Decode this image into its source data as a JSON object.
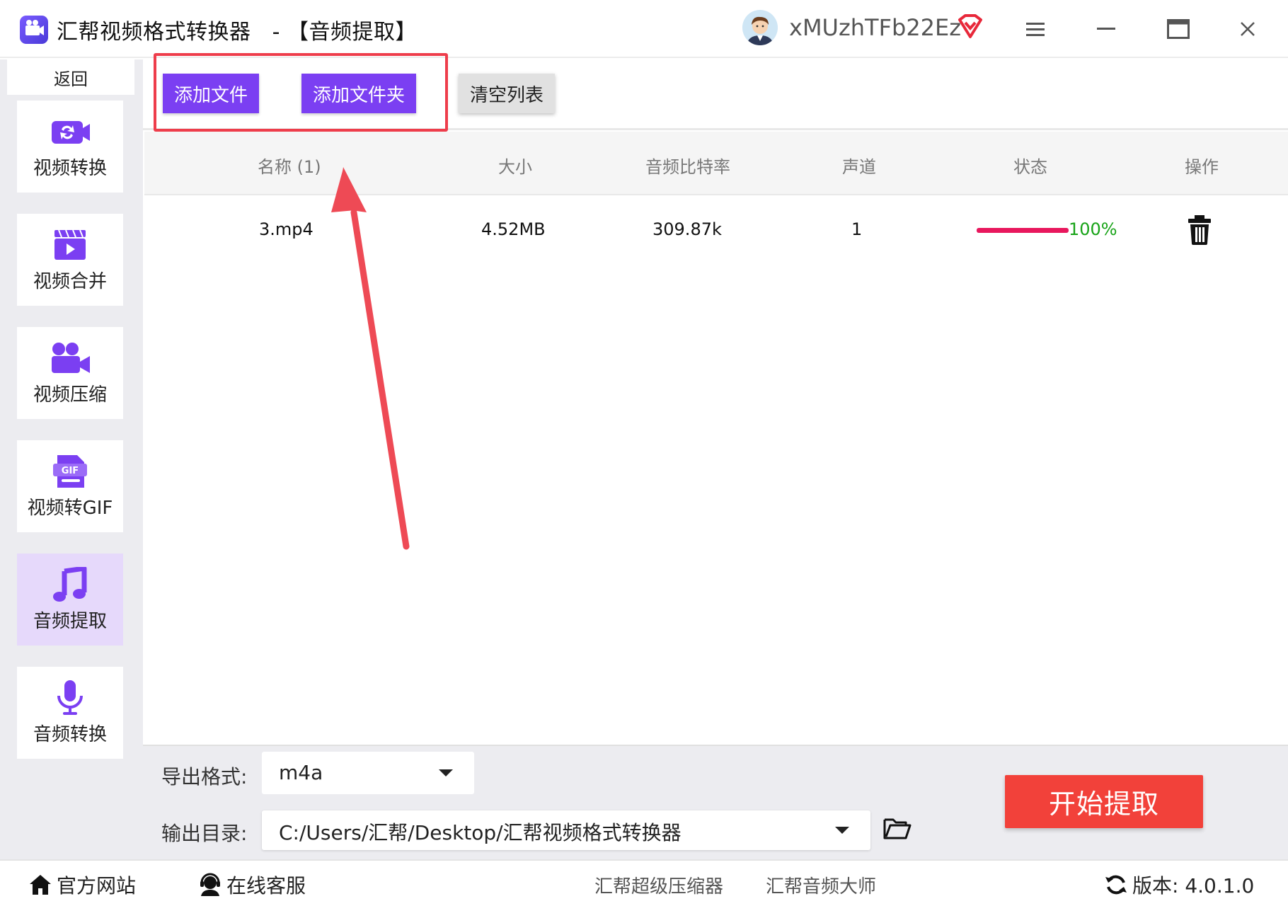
{
  "window": {
    "title": "汇帮视频格式转换器",
    "subtitle": "- 【音频提取】",
    "username": "xMUzhTFb22Ez",
    "icons": [
      "app-logo-icon",
      "avatar",
      "vip-icon",
      "menu-icon",
      "minimize-icon",
      "maximize-icon",
      "close-icon"
    ]
  },
  "sidebar": {
    "back_label": "返回",
    "items": [
      {
        "label": "视频转换",
        "icon": "video-convert-icon"
      },
      {
        "label": "视频合并",
        "icon": "video-merge-icon"
      },
      {
        "label": "视频压缩",
        "icon": "video-compress-icon"
      },
      {
        "label": "视频转GIF",
        "icon": "gif-icon"
      },
      {
        "label": "音频提取",
        "icon": "music-note-icon",
        "active": true
      },
      {
        "label": "音频转换",
        "icon": "microphone-icon"
      }
    ]
  },
  "toolbar": {
    "add_file": "添加文件",
    "add_folder": "添加文件夹",
    "clear_list": "清空列表"
  },
  "table": {
    "columns": [
      "名称 (1)",
      "大小",
      "音频比特率",
      "声道",
      "状态",
      "操作"
    ],
    "rows": [
      {
        "name": "3.mp4",
        "size": "4.52MB",
        "bitrate": "309.87k",
        "channels": "1",
        "progress": 1.0,
        "status_text": "100%"
      }
    ]
  },
  "settings": {
    "format_label": "导出格式:",
    "format_value": "m4a",
    "dir_label": "输出目录:",
    "dir_value": "C:/Users/汇帮/Desktop/汇帮视频格式转换器",
    "start_button": "开始提取"
  },
  "footer": {
    "website": "官方网站",
    "support": "在线客服",
    "link_compressor": "汇帮超级压缩器",
    "link_audio": "汇帮音频大师",
    "version": "版本:  4.0.1.0"
  },
  "colors": {
    "accent": "#7b3ff2",
    "start": "#f2413a",
    "highlight": "#ee3d4b",
    "progress": "#e8175d",
    "status_ok": "#17a317"
  }
}
